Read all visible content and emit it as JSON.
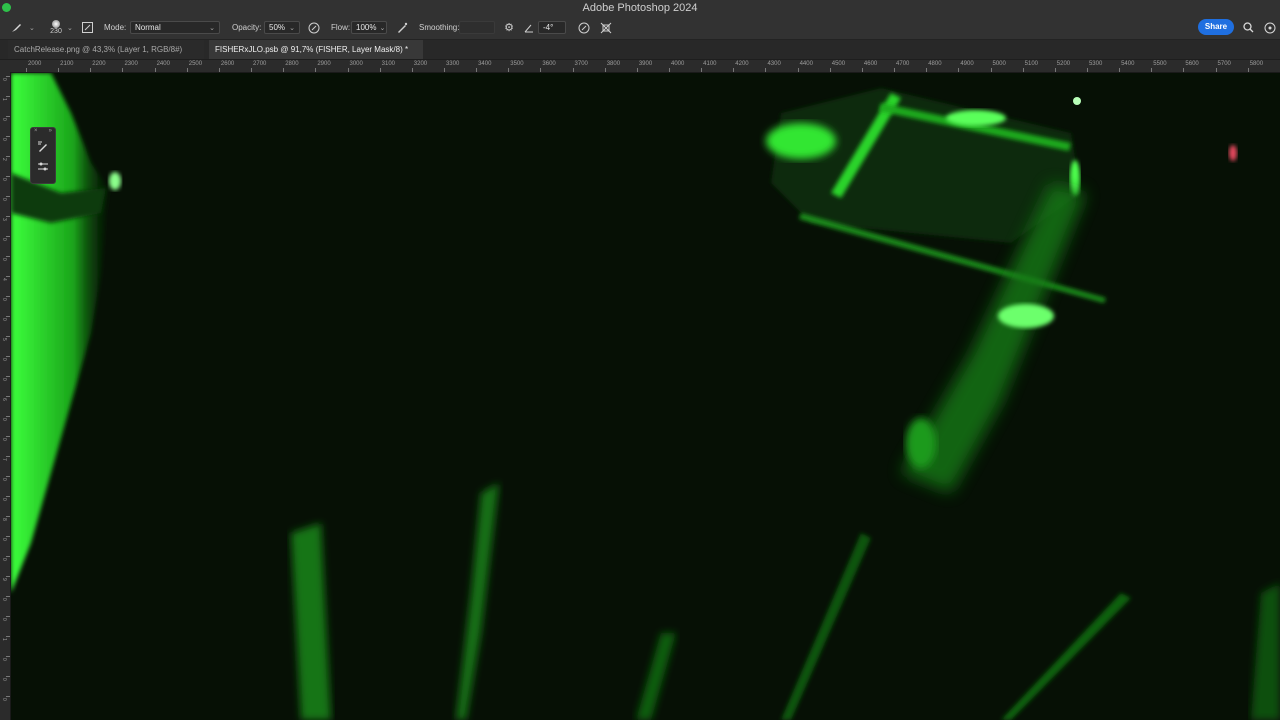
{
  "app": {
    "title": "Adobe Photoshop 2024"
  },
  "options_bar": {
    "brush_size": "230",
    "mode_label": "Mode:",
    "mode_value": "Normal",
    "opacity_label": "Opacity:",
    "opacity_value": "50%",
    "flow_label": "Flow:",
    "flow_value": "100%",
    "smoothing_label": "Smoothing:",
    "smoothing_value": "",
    "angle_value": "-4°",
    "share_label": "Share"
  },
  "tabs": [
    {
      "label": "CatchRelease.png @ 43,3% (Layer 1, RGB/8#)",
      "active": false
    },
    {
      "label": "FISHERxJLO.psb @ 91,7% (FISHER, Layer Mask/8) *",
      "active": true
    }
  ],
  "ruler": {
    "horizontal_labels": [
      "2000",
      "2100",
      "2200",
      "2300",
      "2400",
      "2500",
      "2600",
      "2700",
      "2800",
      "2900",
      "3000",
      "3100",
      "3200",
      "3300",
      "3400",
      "3500",
      "3600",
      "3700",
      "3800",
      "3900",
      "4000",
      "4100",
      "4200",
      "4300",
      "4400",
      "4500",
      "4600",
      "4700",
      "4800",
      "4900",
      "5000",
      "5100",
      "5200",
      "5300",
      "5400",
      "5500",
      "5600",
      "5700",
      "5800"
    ],
    "vertical_labels": [
      "0",
      "1",
      "0",
      "0",
      "2",
      "0",
      "0",
      "3",
      "0",
      "0",
      "4",
      "0",
      "0",
      "5",
      "0",
      "0",
      "6",
      "0",
      "0",
      "7",
      "0",
      "0",
      "8",
      "0",
      "0",
      "9",
      "0",
      "0",
      "1",
      "0",
      "0",
      "0"
    ]
  },
  "colors": {
    "accent": "#1f6fe0",
    "traffic_green": "#2ec24a",
    "canvas_green": "#39ff3a"
  }
}
